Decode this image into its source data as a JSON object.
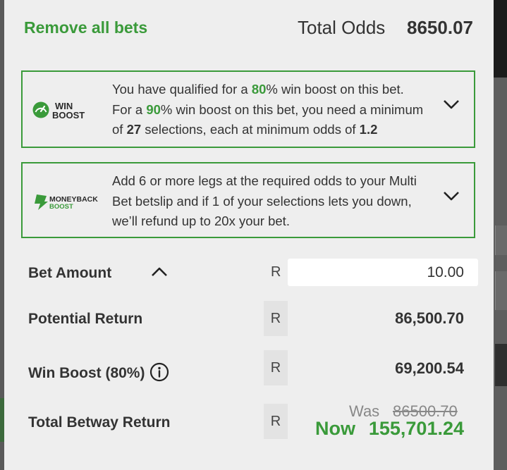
{
  "header": {
    "remove_all_label": "Remove all bets",
    "total_odds_label": "Total Odds",
    "total_odds_value": "8650.07"
  },
  "win_boost_promo": {
    "logo_text_top": "WIN",
    "logo_text_bottom": "BOOST",
    "line1_a": "You have qualified for a ",
    "line1_pct": "80",
    "line1_b": "% win boost on this bet.",
    "line2_a": "For a ",
    "line2_pct": "90",
    "line2_b": "% win boost on this bet, you need a minimum",
    "line3_a": "of ",
    "line3_count": "27",
    "line3_b": " selections, each at minimum odds of ",
    "line3_odds": "1.2",
    "icon": "chevron-down-icon"
  },
  "moneyback_promo": {
    "logo_text_top": "MONEYBACK",
    "logo_text_bottom": "BOOST",
    "line1": "Add 6 or more legs at the required odds to your Multi",
    "line2": "Bet betslip and if 1 of your selections lets you down,",
    "line3": "we’ll refund up to 20x your bet.",
    "icon": "chevron-down-icon"
  },
  "bet_amount": {
    "label": "Bet Amount",
    "currency": "R",
    "value": "10.00",
    "icon": "chevron-up-icon"
  },
  "potential_return": {
    "label": "Potential Return",
    "currency": "R",
    "value": "86,500.70"
  },
  "win_boost_row": {
    "label": "Win Boost (80%)",
    "currency": "R",
    "value": "69,200.54",
    "icon": "info-icon"
  },
  "total_return": {
    "label": "Total Betway Return",
    "currency": "R",
    "was_label": "Was",
    "was_value": "86500.70",
    "now_label": "Now",
    "now_value": "155,701.24"
  },
  "colors": {
    "accent_green": "#3a9a3a",
    "panel_bg": "#eeeeee",
    "text": "#333333"
  }
}
